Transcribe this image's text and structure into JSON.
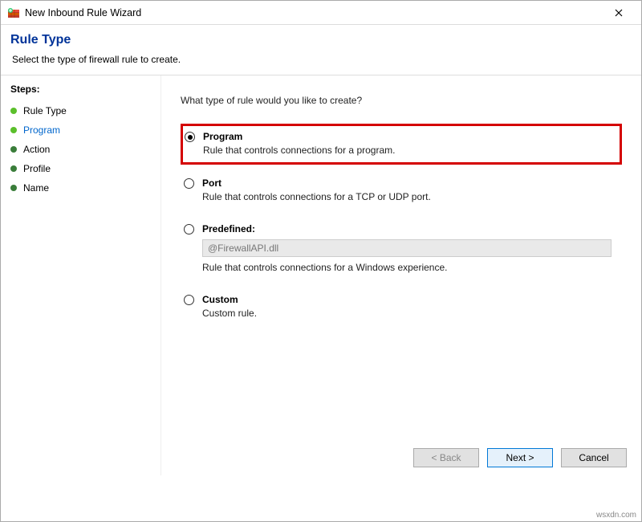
{
  "window": {
    "title": "New Inbound Rule Wizard"
  },
  "header": {
    "title": "Rule Type",
    "subtitle": "Select the type of firewall rule to create."
  },
  "sidebar": {
    "heading": "Steps:",
    "items": [
      {
        "label": "Rule Type"
      },
      {
        "label": "Program"
      },
      {
        "label": "Action"
      },
      {
        "label": "Profile"
      },
      {
        "label": "Name"
      }
    ]
  },
  "main": {
    "prompt": "What type of rule would you like to create?",
    "options": [
      {
        "title": "Program",
        "desc": "Rule that controls connections for a program.",
        "selected": true,
        "highlighted": true
      },
      {
        "title": "Port",
        "desc": "Rule that controls connections for a TCP or UDP port.",
        "selected": false
      },
      {
        "title": "Predefined:",
        "desc": "Rule that controls connections for a Windows experience.",
        "selected": false,
        "dropdown_value": "@FirewallAPI.dll"
      },
      {
        "title": "Custom",
        "desc": "Custom rule.",
        "selected": false
      }
    ]
  },
  "buttons": {
    "back": "< Back",
    "next": "Next >",
    "cancel": "Cancel"
  },
  "watermark": "wsxdn.com"
}
